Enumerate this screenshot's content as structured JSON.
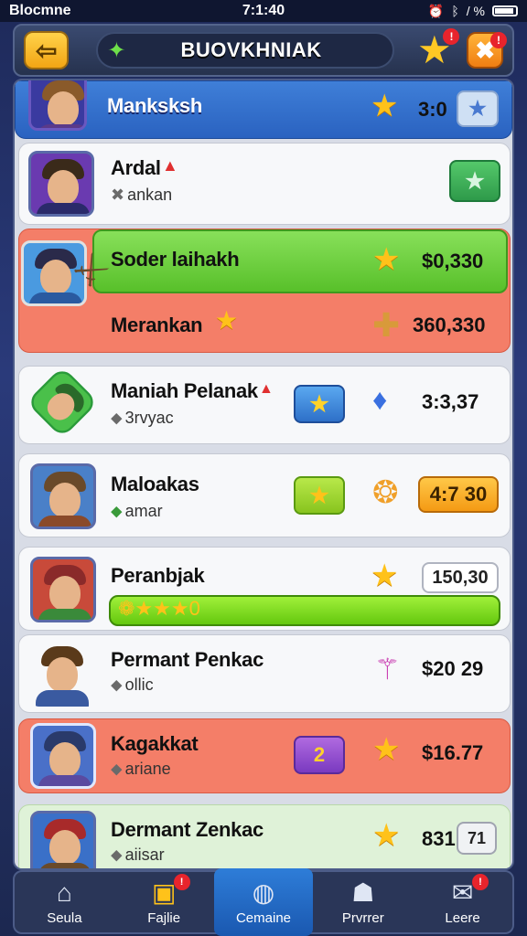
{
  "status_bar": {
    "carrier": "Blocmne",
    "time": "7:1:40",
    "icons": [
      "alarm-icon",
      "bluetooth-icon",
      "signal-icon",
      "battery-icon"
    ],
    "signal_text": "/ %"
  },
  "header": {
    "back_icon": "arrow-left-icon",
    "sparkle_icon": "sparkle-icon",
    "title": "BUOVKHNIAK",
    "star_icon": "star-icon",
    "star_badge": "!",
    "close_badge": "!"
  },
  "pinned_row": {
    "name": "Manksksh",
    "score": "3:0"
  },
  "rows": [
    {
      "name": "Ardal",
      "sub": "ankan",
      "button": "green-star-button"
    },
    {
      "name": "Soder laihakh",
      "score": "$0,330",
      "bar_color": "green"
    },
    {
      "name": "Merankan",
      "score": "360,330",
      "bar_color": "salmon"
    },
    {
      "name": "Maniah Pelanak",
      "sub": "3rvyac",
      "score": "3:3,37"
    },
    {
      "name": "Maloakas",
      "sub": "amar",
      "score": "4:7 30"
    },
    {
      "name": "Peranbjak",
      "score": "150,30",
      "progress": 1.0
    },
    {
      "name": "Permant Penkac",
      "sub": "ollic",
      "score": "$20 29"
    },
    {
      "name": "Kagakkat",
      "sub": "ariane",
      "badge": "2",
      "score": "$16.77"
    },
    {
      "name": "Dermant Zenkac",
      "sub": "aiisar",
      "score": "831",
      "score_box": "71"
    }
  ],
  "nav": [
    {
      "label": "Seula",
      "icon": "home-icon"
    },
    {
      "label": "Fajlie",
      "icon": "star-box-icon",
      "badge": "!"
    },
    {
      "label": "Cemaine",
      "icon": "globe-icon",
      "active": true
    },
    {
      "label": "Prvrrer",
      "icon": "people-icon"
    },
    {
      "label": "Leere",
      "icon": "mail-icon",
      "badge": "!"
    }
  ],
  "colors": {
    "accent_green": "#5fc83a",
    "accent_salmon": "#f47e68",
    "accent_blue": "#3a7ad8",
    "star": "#ffc21a"
  }
}
